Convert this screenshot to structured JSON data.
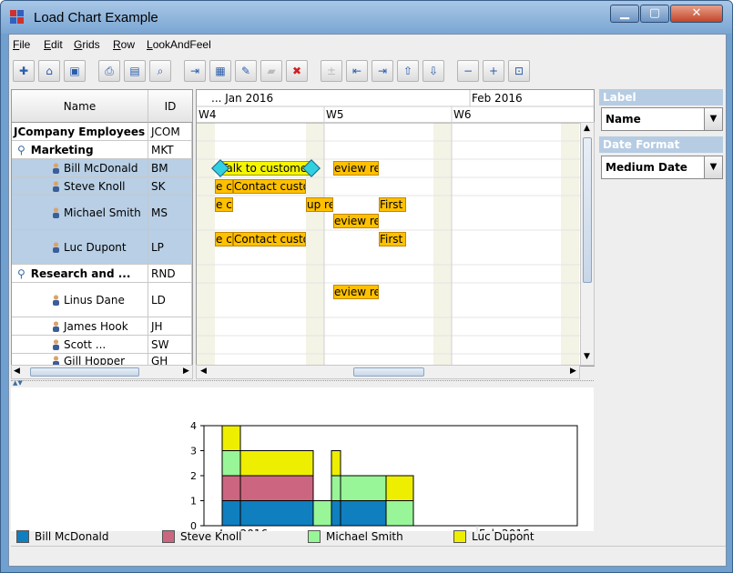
{
  "window": {
    "title": "Load Chart Example"
  },
  "menu": [
    {
      "key": "F",
      "rest": "ile"
    },
    {
      "key": "E",
      "rest": "dit"
    },
    {
      "key": "G",
      "rest": "rids"
    },
    {
      "key": "R",
      "rest": "ow"
    },
    {
      "key": "L",
      "rest": "ookAndFeel"
    }
  ],
  "toolbar": [
    {
      "icon": "new-icon",
      "glyph": "✚",
      "enabled": true
    },
    {
      "icon": "open-icon",
      "glyph": "⌂",
      "enabled": true
    },
    {
      "icon": "save-icon",
      "glyph": "▣",
      "enabled": true
    },
    {
      "icon": "print-icon",
      "glyph": "⎙",
      "enabled": true
    },
    {
      "icon": "print-setup-icon",
      "glyph": "▤",
      "enabled": true
    },
    {
      "icon": "print-preview-icon",
      "glyph": "⌕",
      "enabled": true
    },
    {
      "icon": "insert-row-icon",
      "glyph": "⇥",
      "enabled": true
    },
    {
      "icon": "delete-row-icon",
      "glyph": "▦",
      "enabled": true
    },
    {
      "icon": "edit-row-icon",
      "glyph": "✎",
      "enabled": true
    },
    {
      "icon": "paste-icon",
      "glyph": "▰",
      "enabled": false
    },
    {
      "icon": "delete-icon",
      "glyph": "✖",
      "enabled": true
    },
    {
      "icon": "add-child-icon",
      "glyph": "±",
      "enabled": false
    },
    {
      "icon": "outdent-icon",
      "glyph": "⇤",
      "enabled": true
    },
    {
      "icon": "indent-icon",
      "glyph": "⇥",
      "enabled": true
    },
    {
      "icon": "move-up-icon",
      "glyph": "⇧",
      "enabled": true
    },
    {
      "icon": "move-down-icon",
      "glyph": "⇩",
      "enabled": true
    },
    {
      "icon": "zoom-out-icon",
      "glyph": "−",
      "enabled": true
    },
    {
      "icon": "zoom-in-icon",
      "glyph": "+",
      "enabled": true
    },
    {
      "icon": "zoom-fit-icon",
      "glyph": "⊡",
      "enabled": true
    }
  ],
  "table": {
    "headers": {
      "name": "Name",
      "id": "ID"
    },
    "rows": [
      {
        "name": "JCompany Employees",
        "id": "JCOM",
        "level": 0,
        "bold": true,
        "kind": "root",
        "h": 20
      },
      {
        "name": "Marketing",
        "id": "MKT",
        "level": 1,
        "bold": true,
        "kind": "group",
        "h": 20
      },
      {
        "name": "Bill McDonald",
        "id": "BM",
        "level": 2,
        "bold": false,
        "kind": "person",
        "h": 20,
        "selected": true
      },
      {
        "name": "Steve Knoll",
        "id": "SK",
        "level": 2,
        "bold": false,
        "kind": "person",
        "h": 20,
        "selected": true
      },
      {
        "name": "Michael Smith",
        "id": "MS",
        "level": 2,
        "bold": false,
        "kind": "person",
        "h": 38,
        "selected": true
      },
      {
        "name": "Luc Dupont",
        "id": "LP",
        "level": 2,
        "bold": false,
        "kind": "person",
        "h": 38,
        "selected": true
      },
      {
        "name": "Research and ...",
        "id": "RND",
        "level": 1,
        "bold": true,
        "kind": "group",
        "h": 20
      },
      {
        "name": "Linus Dane",
        "id": "LD",
        "level": 2,
        "bold": false,
        "kind": "person",
        "h": 38
      },
      {
        "name": "James Hook",
        "id": "JH",
        "level": 2,
        "bold": false,
        "kind": "person",
        "h": 20
      },
      {
        "name": "Scott ...",
        "id": "SW",
        "level": 2,
        "bold": false,
        "kind": "person",
        "h": 20
      },
      {
        "name": "Gill Hopper",
        "id": "GH",
        "level": 2,
        "bold": false,
        "kind": "person",
        "h": 16
      }
    ]
  },
  "gantt": {
    "months": [
      "... Jan 2016",
      "Feb 2016"
    ],
    "weeks": [
      "W4",
      "W5",
      "W6"
    ],
    "activities": [
      {
        "label": "Talk to customers",
        "row": 2,
        "lane": 0,
        "from": 0.3,
        "to": 5.3,
        "style": "y",
        "handles": true
      },
      {
        "label": "eview requiremen",
        "row": 2,
        "lane": 0,
        "from": 6.5,
        "to": 9.0
      },
      {
        "label": "e custo",
        "row": 3,
        "lane": 0,
        "from": 0.0,
        "to": 1.0
      },
      {
        "label": "Contact customers",
        "row": 3,
        "lane": 0,
        "from": 1.0,
        "to": 5.0
      },
      {
        "label": "e custo",
        "row": 4,
        "lane": 0,
        "from": 0.0,
        "to": 1.0
      },
      {
        "label": "up requirer",
        "row": 4,
        "lane": 0,
        "from": 5.0,
        "to": 6.5
      },
      {
        "label": "First Draft",
        "row": 4,
        "lane": 0,
        "from": 9.0,
        "to": 10.5
      },
      {
        "label": "eview requiremen",
        "row": 4,
        "lane": 1,
        "from": 6.5,
        "to": 9.0
      },
      {
        "label": "e custo",
        "row": 5,
        "lane": 0,
        "from": 0.0,
        "to": 1.0
      },
      {
        "label": "Contact customers",
        "row": 5,
        "lane": 0,
        "from": 1.0,
        "to": 5.0
      },
      {
        "label": "First Draft",
        "row": 5,
        "lane": 0,
        "from": 9.0,
        "to": 10.5
      },
      {
        "label": "eview requiremen",
        "row": 7,
        "lane": 0,
        "from": 6.5,
        "to": 9.0
      }
    ]
  },
  "right_panel": {
    "label_title": "Label",
    "label_value": "Name",
    "date_format_title": "Date Format",
    "date_format_value": "Medium Date"
  },
  "chart_data": {
    "type": "area",
    "title": "",
    "xlabel": "",
    "ylabel": "",
    "ylim": [
      0,
      4
    ],
    "yticks": [
      "0",
      "1",
      "2",
      "3",
      "4"
    ],
    "x_axis_months": [
      "... Jan 2016",
      "Feb 2016"
    ],
    "x_axis_weeks": [
      "W4",
      "W5",
      "W6"
    ],
    "x_unit": "day offset from start of visible range (Jan 2016)",
    "intervals": [
      {
        "from": 0,
        "to": 1,
        "bm": 1,
        "sk": 1,
        "ms": 1,
        "lp": 1
      },
      {
        "from": 1,
        "to": 5,
        "bm": 1,
        "sk": 1,
        "ms": 0,
        "lp": 1
      },
      {
        "from": 5,
        "to": 6,
        "bm": 0,
        "sk": 0,
        "ms": 1,
        "lp": 0
      },
      {
        "from": 6,
        "to": 6.5,
        "bm": 1,
        "sk": 0,
        "ms": 1,
        "lp": 1
      },
      {
        "from": 6.5,
        "to": 9,
        "bm": 1,
        "sk": 0,
        "ms": 1,
        "lp": 0
      },
      {
        "from": 9,
        "to": 10.5,
        "bm": 0,
        "sk": 0,
        "ms": 1,
        "lp": 1
      }
    ],
    "series": [
      {
        "name": "Bill McDonald",
        "color": "#0f7fc0",
        "key": "bm"
      },
      {
        "name": "Steve Knoll",
        "color": "#cc6680",
        "key": "sk"
      },
      {
        "name": "Michael Smith",
        "color": "#98f598",
        "key": "ms"
      },
      {
        "name": "Luc Dupont",
        "color": "#eeee00",
        "key": "lp"
      }
    ]
  }
}
